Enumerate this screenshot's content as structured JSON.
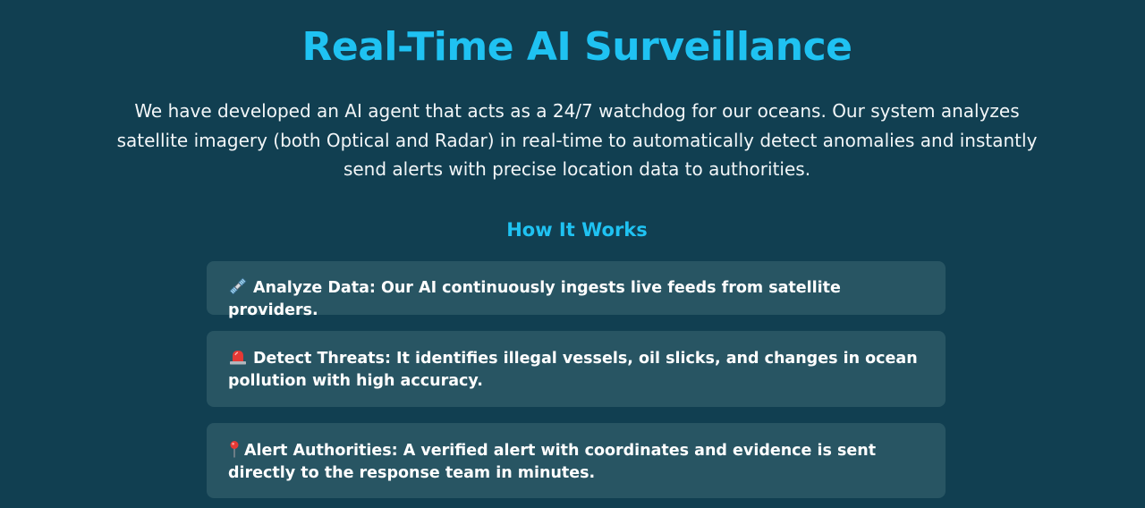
{
  "header": {
    "title": "Real-Time AI Surveillance",
    "intro": "We have developed an AI agent that acts as a 24/7 watchdog for our oceans. Our system analyzes satellite imagery (both Optical and Radar) in real-time to automatically detect anomalies and instantly send alerts with precise location data to authorities."
  },
  "how_it_works": {
    "heading": "How It Works",
    "steps": [
      {
        "icon": "satellite-icon",
        "text": "Analyze Data: Our AI continuously ingests live feeds from satellite providers."
      },
      {
        "icon": "siren-icon",
        "text": "Detect Threats: It identifies illegal vessels, oil slicks, and changes in ocean pollution with high accuracy."
      },
      {
        "icon": "pin-icon",
        "text": "Alert Authorities: A verified alert with coordinates and evidence is sent directly to the response team in minutes."
      }
    ]
  },
  "colors": {
    "background": "#113f51",
    "accent": "#1fc2f2",
    "card": "#285563",
    "text": "#ffffff"
  }
}
